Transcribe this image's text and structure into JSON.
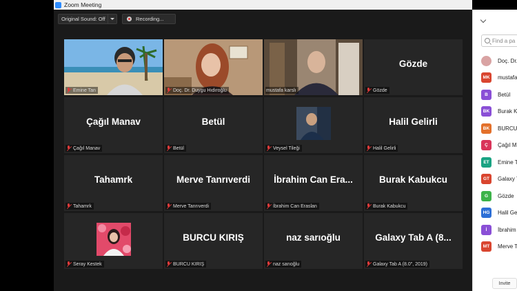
{
  "window": {
    "title": "Zoom Meeting"
  },
  "controls": {
    "original_sound": "Original Sound: Off",
    "recording": "Recording..."
  },
  "tiles": [
    {
      "label": "Emine Tan"
    },
    {
      "label": "Doç. Dr. Duygu Hıdıroğlu"
    },
    {
      "label": "mustafa karslı"
    },
    {
      "name": "Gözde",
      "label": "Gözde"
    },
    {
      "name": "Çağıl Manav",
      "label": "Çağıl Manav"
    },
    {
      "name": "Betül",
      "label": "Betül"
    },
    {
      "label": "Veysel Tileği"
    },
    {
      "name": "Halil Gelirli",
      "label": "Halil Gelirli"
    },
    {
      "name": "Tahamrk",
      "label": "Tahamrk"
    },
    {
      "name": "Merve Tanrıverdi",
      "label": "Merve Tanrıverdi"
    },
    {
      "name": "İbrahim  Can  Era...",
      "label": "İbrahim Can Eraslan"
    },
    {
      "name": "Burak Kabukcu",
      "label": "Burak Kabukcu"
    },
    {
      "label": "Seray Kestek"
    },
    {
      "name": "BURCU KIRIŞ",
      "label": "BURCU KIRIŞ"
    },
    {
      "name": "naz sarıoğlu",
      "label": "naz sarıoğlu"
    },
    {
      "name": "Galaxy Tab A (8...",
      "label": "Galaxy Tab A (8.0\", 2019)"
    }
  ],
  "participants_panel": {
    "search_placeholder": "Find a pa",
    "invite_label": "Invite",
    "participants": [
      {
        "initials": "",
        "name": "Doç. Dr.",
        "color": "#d9a3a3"
      },
      {
        "initials": "MK",
        "name": "mustafa",
        "color": "#d9452f"
      },
      {
        "initials": "B",
        "name": "Betül",
        "color": "#8a4fd6"
      },
      {
        "initials": "BK",
        "name": "Burak K",
        "color": "#8a4fd6"
      },
      {
        "initials": "BK",
        "name": "BURCU",
        "color": "#e3702a"
      },
      {
        "initials": "Ç",
        "name": "Çağıl M",
        "color": "#d9345a"
      },
      {
        "initials": "ET",
        "name": "Emine T",
        "color": "#1aa383"
      },
      {
        "initials": "GT",
        "name": "Galaxy T",
        "color": "#d9452f"
      },
      {
        "initials": "G",
        "name": "Gözde",
        "color": "#3db34a"
      },
      {
        "initials": "HG",
        "name": "Halil Ge",
        "color": "#2d6fd6"
      },
      {
        "initials": "İ",
        "name": "İbrahim",
        "color": "#8a4fd6"
      },
      {
        "initials": "MT",
        "name": "Merve T",
        "color": "#d9452f"
      }
    ]
  }
}
